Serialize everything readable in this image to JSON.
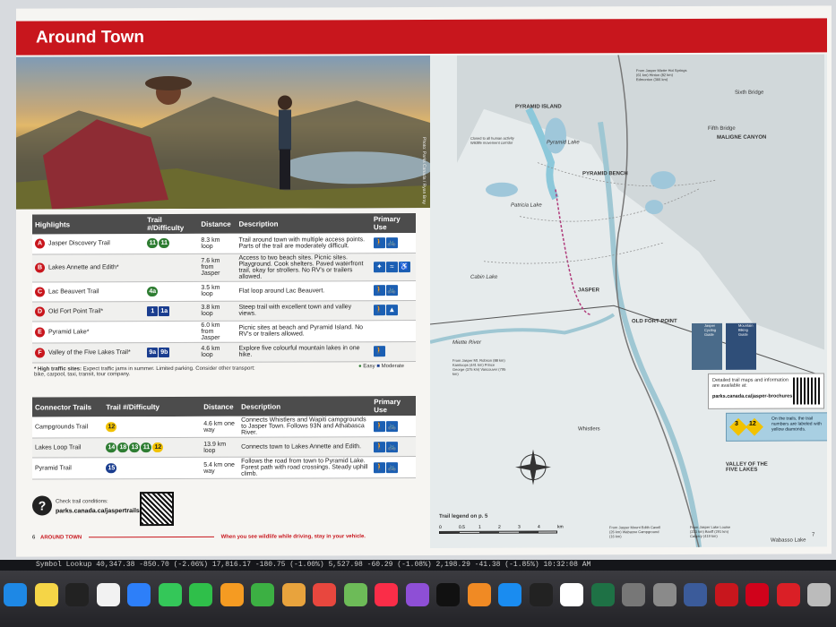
{
  "header": {
    "title": "Around Town"
  },
  "photo": {
    "credit": "Photo: Parks Canada / Ryan Bray"
  },
  "highlights": {
    "headers": [
      "Highlights",
      "Trail #/Difficulty",
      "Distance",
      "Description",
      "Primary Use"
    ],
    "rows": [
      {
        "letter": "A",
        "name": "Jasper Discovery Trail",
        "badges": [
          "11",
          "11"
        ],
        "distance": "8.3 km loop",
        "description": "Trail around town with multiple access points. Parts of the trail are moderately difficult.",
        "uses": [
          "hiker-icon",
          "bike-icon"
        ]
      },
      {
        "letter": "B",
        "name": "Lakes Annette and Edith*",
        "badges": [],
        "distance": "7.6 km from Jasper",
        "description": "Access to two beach sites. Picnic sites. Playground. Cook shelters. Paved waterfront trail, okay for strollers. No RV's or trailers allowed.",
        "uses": [
          "stroller-icon",
          "swim-icon",
          "wheelchair-icon"
        ]
      },
      {
        "letter": "C",
        "name": "Lac Beauvert Trail",
        "badges": [
          "4a"
        ],
        "distance": "3.5 km loop",
        "description": "Flat loop around Lac Beauvert.",
        "uses": [
          "hiker-icon",
          "bike-icon"
        ]
      },
      {
        "letter": "D",
        "name": "Old Fort Point Trail*",
        "badges": [
          "1",
          "1a"
        ],
        "distance": "3.8 km loop",
        "description": "Steep trail with excellent town and valley views.",
        "uses": [
          "hiker-icon",
          "viewpoint-icon"
        ]
      },
      {
        "letter": "E",
        "name": "Pyramid Lake*",
        "badges": [],
        "distance": "6.0 km from Jasper",
        "description": "Picnic sites at beach and Pyramid Island. No RV's or trailers allowed.",
        "uses": []
      },
      {
        "letter": "F",
        "name": "Valley of the Five Lakes Trail*",
        "badges": [
          "9a",
          "9b"
        ],
        "distance": "4.6 km loop",
        "description": "Explore five colourful mountain lakes in one hike.",
        "uses": [
          "hiker-icon"
        ]
      }
    ],
    "footnote_bold": "* High traffic sites:",
    "footnote": "Expect traffic jams in summer. Limited parking. Consider other transport: bike, carpool, taxi, transit, tour company.",
    "legend_easy": "Easy",
    "legend_moderate": "Moderate"
  },
  "connectors": {
    "headers": [
      "Connector Trails",
      "Trail #/Difficulty",
      "Distance",
      "Description",
      "Primary Use"
    ],
    "rows": [
      {
        "name": "Campgrounds Trail",
        "badges": [
          "12"
        ],
        "distance": "4.6 km one way",
        "description": "Connects Whistlers and Wapiti campgrounds to Jasper Town. Follows 93N and Athabasca River.",
        "uses": [
          "hiker-icon",
          "bike-icon"
        ]
      },
      {
        "name": "Lakes Loop Trail",
        "badges": [
          "14",
          "18",
          "13",
          "11",
          "12"
        ],
        "distance": "13.9 km loop",
        "description": "Connects town to Lakes Annette and Edith.",
        "uses": [
          "hiker-icon",
          "bike-icon"
        ]
      },
      {
        "name": "Pyramid Trail",
        "badges": [
          "15"
        ],
        "distance": "5.4 km one way",
        "description": "Follows the road from town to Pyramid Lake. Forest path with road crossings. Steady uphill climb.",
        "uses": [
          "hiker-icon",
          "bike-icon"
        ]
      }
    ]
  },
  "conditions": {
    "label": "Check trail conditions:",
    "url": "parks.canada.ca/jaspertrails"
  },
  "footer": {
    "page_left": "6",
    "section": "AROUND TOWN",
    "wildlife": "When you see wildlife while driving, stay in your vehicle.",
    "page_right": "7"
  },
  "map": {
    "labels": [
      "PYRAMID ISLAND",
      "PYRAMID BENCH",
      "Patricia Lake",
      "Cabin Lake",
      "JASPER",
      "OLD FORT POINT",
      "MALIGNE CANYON",
      "VALLEY OF THE FIVE LAKES",
      "Whistlers",
      "Miette River",
      "Wabasso Lake",
      "Fifth Bridge",
      "Sixth Bridge",
      "Pyramid Lake"
    ],
    "closures": [
      "Closed to all human activity Wildlife movement corridor"
    ],
    "from_jasper_nw": "From Jasper Mt. Robson (88 km) Kamloops (441 km) Prince George (375 km) Vancouver (795 km)",
    "from_jasper_ne": "From Jasper Miette Hot Springs (61 km) Hinton (82 km) Edmonton (366 km)",
    "from_jasper_s1": "From Jasper Mount Edith Cavell (26 km) Wabasso Campground (16 km)",
    "from_jasper_s2": "From Jasper Lake Louise (233 km) Banff (291 km) Calgary (419 km)",
    "brochure_text": "Detailed trail maps and information are available at:",
    "brochure_url": "parks.canada.ca/jasper-brochures",
    "diamond_text": "On the trails, the trail numbers are labeled with yellow diamonds.",
    "diamonds": [
      "3",
      "12"
    ],
    "legend_ref": "Trail legend on p. 5",
    "scale": [
      "0",
      "0.5",
      "1",
      "2",
      "3",
      "4",
      "km"
    ],
    "guide_titles": [
      "Jasper Cycling Guide",
      "Mountain Biking Guide"
    ]
  },
  "menubar": {
    "text": "Symbol Lookup   40,347.38 -850.70 (-2.06%)   17,816.17 -180.75 (-1.00%)   5,527.98 -60.29 (-1.08%)   2,198.29 -41.38 (-1.85%)   10:32:08 AM"
  },
  "dock": {
    "apps": [
      "Finder",
      "Notes",
      "Freeform",
      "Reminders",
      "Maps",
      "Messages",
      "FaceTime",
      "Pages",
      "Numbers",
      "Keynote",
      "News",
      "Photos",
      "Music",
      "Podcasts",
      "TV",
      "Books",
      "App Store",
      "Stocks",
      "Chrome",
      "Excel",
      "Help",
      "Settings",
      "Preview",
      "Acrobat",
      "PDF",
      "Creative Cloud",
      "Trash"
    ]
  }
}
